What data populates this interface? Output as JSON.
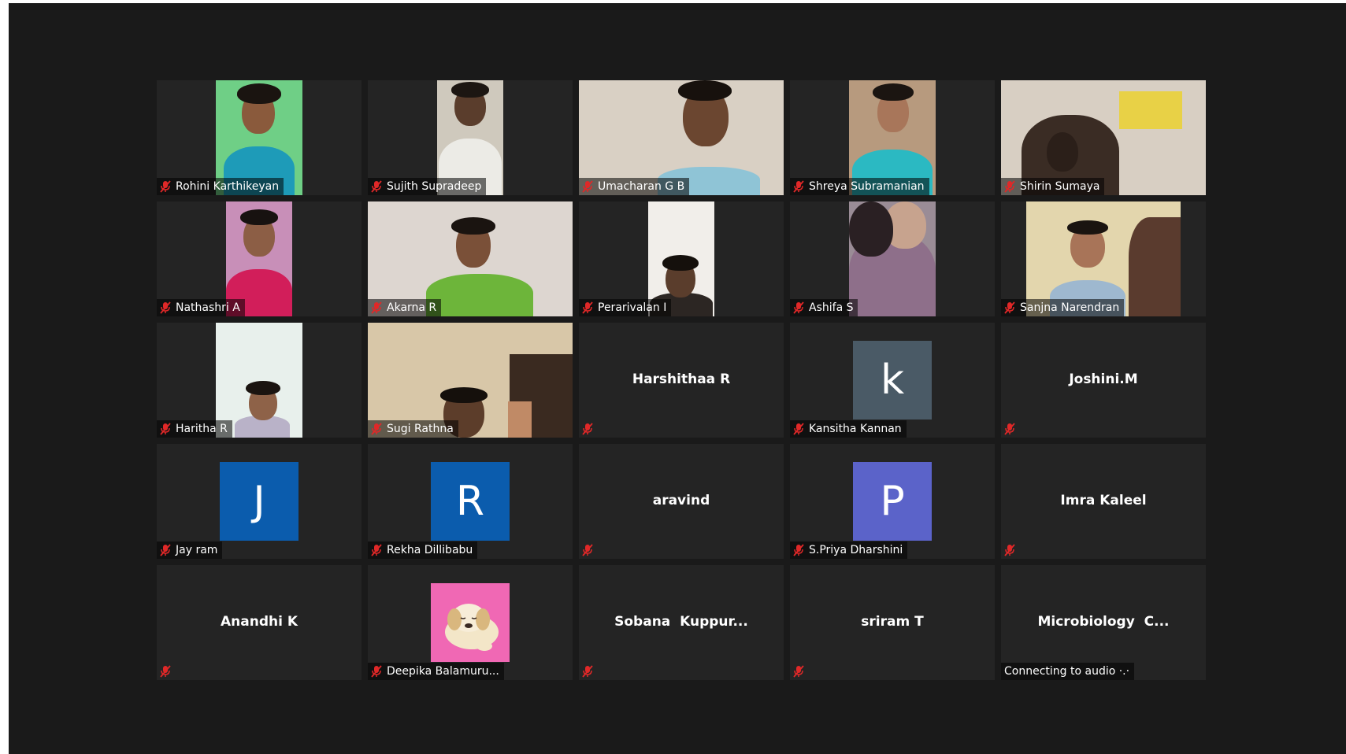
{
  "colors": {
    "app_bg": "#1a1a1a",
    "tile_bg": "#242424",
    "mute_red": "#e02828"
  },
  "participants": [
    {
      "name": "Rohini Karthikeyan",
      "type": "video"
    },
    {
      "name": "Sujith Supradeep",
      "type": "video"
    },
    {
      "name": "Umacharan G B",
      "type": "video"
    },
    {
      "name": "Shreya Subramanian",
      "type": "video"
    },
    {
      "name": "Shirin Sumaya",
      "type": "video"
    },
    {
      "name": "Nathashri A",
      "type": "video"
    },
    {
      "name": "Akarna R",
      "type": "video"
    },
    {
      "name": "Perarivalan I",
      "type": "video"
    },
    {
      "name": "Ashifa S",
      "type": "video"
    },
    {
      "name": "Sanjna Narendran",
      "type": "video"
    },
    {
      "name": "Haritha R",
      "type": "video"
    },
    {
      "name": "Sugi Rathna",
      "type": "video"
    },
    {
      "name": "Harshithaa R",
      "type": "name-only"
    },
    {
      "name": "Kansitha Kannan",
      "type": "avatar",
      "initial": "k",
      "avatar_color": "#4a5a66"
    },
    {
      "name": "Joshini.M",
      "type": "name-only"
    },
    {
      "name": "Jay ram",
      "type": "avatar",
      "initial": "J",
      "avatar_color": "#0b5cad"
    },
    {
      "name": "Rekha Dillibabu",
      "type": "avatar",
      "initial": "R",
      "avatar_color": "#0b5cad"
    },
    {
      "name": "aravind",
      "type": "name-only"
    },
    {
      "name": "S.Priya Dharshini",
      "type": "avatar",
      "initial": "P",
      "avatar_color": "#5b63c9"
    },
    {
      "name": "Imra Kaleel",
      "type": "name-only"
    },
    {
      "name": "Anandhi K",
      "type": "name-only"
    },
    {
      "name": "Deepika Balamuru...",
      "type": "picture"
    },
    {
      "name": "Sobana  Kuppur...",
      "type": "name-only"
    },
    {
      "name": "sriram T",
      "type": "name-only"
    },
    {
      "name": "Microbiology  C...",
      "type": "name-only",
      "status": "Connecting to audio ·.·"
    }
  ]
}
